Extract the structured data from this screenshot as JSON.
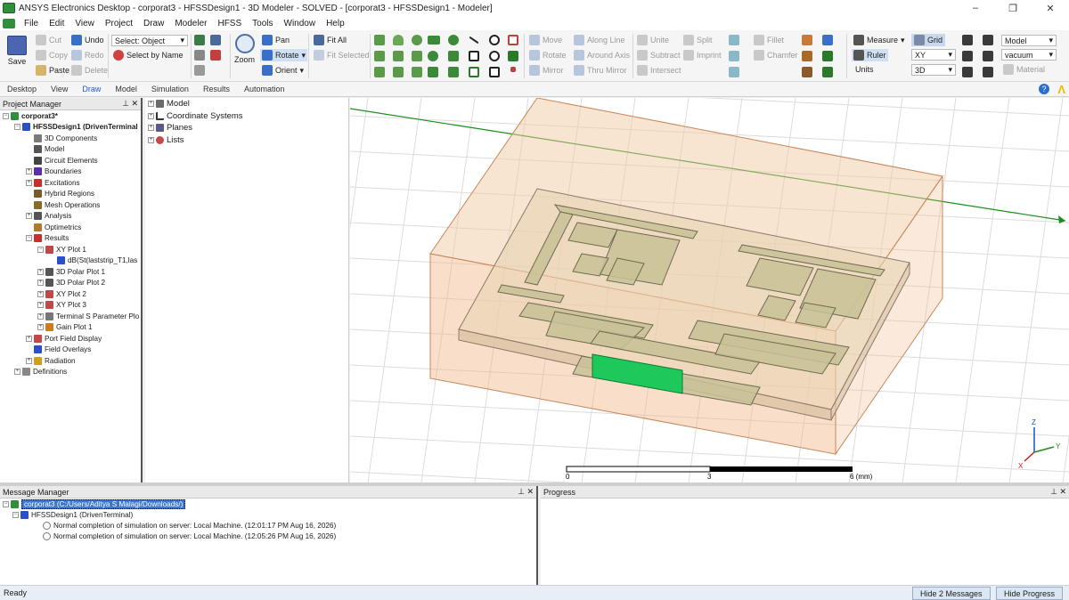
{
  "window": {
    "title": "ANSYS Electronics Desktop - corporat3 - HFSSDesign1 - 3D Modeler - SOLVED - [corporat3 - HFSSDesign1 - Modeler]",
    "controls": [
      "–",
      "❐",
      "✕"
    ]
  },
  "menu": [
    "File",
    "Edit",
    "View",
    "Project",
    "Draw",
    "Modeler",
    "HFSS",
    "Tools",
    "Window",
    "Help"
  ],
  "ribbon": {
    "save": "Save",
    "cut": "Cut",
    "copy": "Copy",
    "paste": "Paste",
    "undo": "Undo",
    "redo": "Redo",
    "delete": "Delete",
    "select_value": "Select: Object",
    "select_by_name": "Select by Name",
    "zoom": "Zoom",
    "pan": "Pan",
    "rotate": "Rotate",
    "orient": "Orient",
    "fit_all": "Fit All",
    "fit_selected": "Fit Selected",
    "move": "Move",
    "rotate2": "Rotate",
    "mirror": "Mirror",
    "along_line": "Along Line",
    "around_axis": "Around Axis",
    "thru_mirror": "Thru Mirror",
    "unite": "Unite",
    "subtract": "Subtract",
    "intersect": "Intersect",
    "split": "Split",
    "imprint": "Imprint",
    "fillet": "Fillet",
    "chamfer": "Chamfer",
    "measure": "Measure",
    "ruler": "Ruler",
    "units": "Units",
    "grid": "Grid",
    "plane_value": "XY",
    "dim_value": "3D",
    "model_value": "Model",
    "material_value": "vacuum",
    "material": "Material"
  },
  "tabs": [
    "Desktop",
    "View",
    "Draw",
    "Model",
    "Simulation",
    "Results",
    "Automation"
  ],
  "project_manager": {
    "title": "Project Manager",
    "pin": "⊥ ✕",
    "items": [
      {
        "t": "corporat3*",
        "lvl": 0,
        "exp": "−",
        "c": "#2f8f3a",
        "b": true
      },
      {
        "t": "HFSSDesign1 (DrivenTerminal",
        "lvl": 1,
        "exp": "−",
        "c": "#2a4fc8",
        "b": true
      },
      {
        "t": "3D Components",
        "lvl": 2,
        "exp": "",
        "c": "#7a7a7a"
      },
      {
        "t": "Model",
        "lvl": 2,
        "exp": "",
        "c": "#555"
      },
      {
        "t": "Circuit Elements",
        "lvl": 2,
        "exp": "",
        "c": "#444"
      },
      {
        "t": "Boundaries",
        "lvl": 2,
        "exp": "+",
        "c": "#5a2fa8"
      },
      {
        "t": "Excitations",
        "lvl": 2,
        "exp": "+",
        "c": "#c83030"
      },
      {
        "t": "Hybrid Regions",
        "lvl": 2,
        "exp": "",
        "c": "#7a5c2a"
      },
      {
        "t": "Mesh Operations",
        "lvl": 2,
        "exp": "",
        "c": "#8a6a2a"
      },
      {
        "t": "Analysis",
        "lvl": 2,
        "exp": "+",
        "c": "#555"
      },
      {
        "t": "Optimetrics",
        "lvl": 2,
        "exp": "",
        "c": "#b07a2a"
      },
      {
        "t": "Results",
        "lvl": 2,
        "exp": "−",
        "c": "#c83030"
      },
      {
        "t": "XY Plot 1",
        "lvl": 3,
        "exp": "−",
        "c": "#c04848"
      },
      {
        "t": "dB(St(laststrip_T1,las",
        "lvl": 4,
        "exp": "",
        "c": "#2a4fc8"
      },
      {
        "t": "3D Polar Plot 1",
        "lvl": 3,
        "exp": "+",
        "c": "#555"
      },
      {
        "t": "3D Polar Plot 2",
        "lvl": 3,
        "exp": "+",
        "c": "#555"
      },
      {
        "t": "XY Plot 2",
        "lvl": 3,
        "exp": "+",
        "c": "#c04848"
      },
      {
        "t": "XY Plot 3",
        "lvl": 3,
        "exp": "+",
        "c": "#c04848"
      },
      {
        "t": "Terminal S Parameter Plo",
        "lvl": 3,
        "exp": "+",
        "c": "#777"
      },
      {
        "t": "Gain Plot 1",
        "lvl": 3,
        "exp": "+",
        "c": "#d07a1a"
      },
      {
        "t": "Port Field Display",
        "lvl": 2,
        "exp": "+",
        "c": "#c04848"
      },
      {
        "t": "Field Overlays",
        "lvl": 2,
        "exp": "",
        "c": "#2a4fc8"
      },
      {
        "t": "Radiation",
        "lvl": 2,
        "exp": "+",
        "c": "#d0a01a"
      },
      {
        "t": "Definitions",
        "lvl": 1,
        "exp": "+",
        "c": "#888"
      }
    ]
  },
  "model_tree": [
    "Model",
    "Coordinate Systems",
    "Planes",
    "Lists"
  ],
  "viewport": {
    "scale": [
      "0",
      "3",
      "6 (mm)"
    ],
    "axes": {
      "z": "Z",
      "y": "Y",
      "x": "X"
    }
  },
  "message_manager": {
    "title": "Message Manager",
    "pin": "⊥ ✕",
    "project": "corporat3 (C:/Users/Aditya S Malagi/Downloads/)",
    "design": "HFSSDesign1 (DrivenTerminal)",
    "msgs": [
      "Normal completion of simulation on server: Local Machine. (12:01:17 PM  Aug 16, 2026)",
      "Normal completion of simulation on server: Local Machine. (12:05:26 PM  Aug 16, 2026)"
    ]
  },
  "progress": {
    "title": "Progress",
    "pin": "⊥ ✕"
  },
  "status": {
    "text": "Ready",
    "hide_messages": "Hide 2 Messages",
    "hide_progress": "Hide Progress"
  }
}
